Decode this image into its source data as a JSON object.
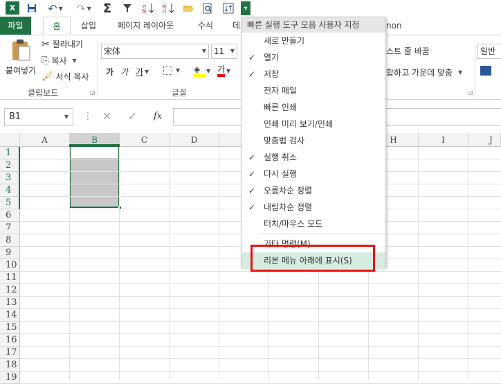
{
  "qat": {
    "logo": "X",
    "undo_icon": "undo-icon",
    "redo_icon": "redo-icon",
    "sigma": "Σ",
    "funnel": "funnel-icon",
    "customize_arrow": "▾"
  },
  "tabs": [
    "파일",
    "홈",
    "삽입",
    "페이지 레이아웃",
    "수식",
    "데"
  ],
  "tab_partial_right": "non",
  "ribbon": {
    "paste": "붙여넣기",
    "cut": "잘라내기",
    "copy": "복사",
    "format_painter": "서식 복사",
    "clipboard_label": "클립보드",
    "font_name": "宋体",
    "font_size": "11",
    "font_label": "글꼴",
    "bold": "가",
    "italic": "가",
    "underline": "가",
    "font_color_letter": "가",
    "wrap_text": "스트 줄 바꿈",
    "merge_center": "합하고 가운데 맞춤",
    "number_format": "일반"
  },
  "formula_bar": {
    "name_box": "B1",
    "fx": "fx"
  },
  "grid": {
    "columns": [
      "A",
      "B",
      "C",
      "D",
      "H",
      "I",
      "J"
    ],
    "rows": [
      "1",
      "2",
      "3",
      "4",
      "5",
      "6",
      "7",
      "8",
      "9",
      "10",
      "11",
      "12",
      "13",
      "14",
      "15",
      "16",
      "17",
      "18",
      "19"
    ]
  },
  "menu": {
    "title": "빠른 실행 도구 모음 사용자 지정",
    "items": [
      {
        "label": "새로 만들기",
        "checked": false
      },
      {
        "label": "열기",
        "checked": true
      },
      {
        "label": "저장",
        "checked": true
      },
      {
        "label": "전자 메일",
        "checked": false
      },
      {
        "label": "빠른 인쇄",
        "checked": false
      },
      {
        "label": "인쇄 미리 보기/인쇄",
        "checked": false
      },
      {
        "label": "맞춤법 검사",
        "checked": false
      },
      {
        "label": "실행 취소",
        "checked": true
      },
      {
        "label": "다시 실행",
        "checked": true
      },
      {
        "label": "오름차순 정렬",
        "checked": true
      },
      {
        "label": "내림차순 정렬",
        "checked": true
      },
      {
        "label": "터치/마우스 모드",
        "checked": false
      }
    ],
    "more_commands": "기타 명령(M)...",
    "show_below": "리본 메뉴 아래에 표시(S)",
    "check_mark": "✓"
  },
  "colors": {
    "excel_green": "#217346",
    "highlight_red": "#e81010",
    "menu_hover": "#d7ece1"
  }
}
